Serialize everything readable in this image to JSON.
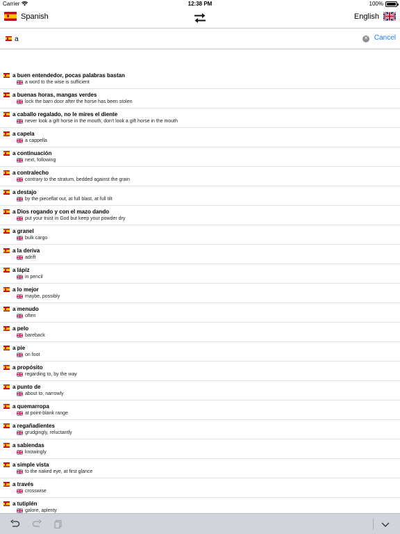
{
  "status": {
    "carrier": "Carrier",
    "time": "12:38 PM",
    "battery": "100%"
  },
  "nav": {
    "source_language": "Spanish",
    "target_language": "English"
  },
  "search": {
    "query": "a",
    "placeholder": "",
    "cancel_label": "Cancel"
  },
  "results": [
    {
      "term": "a buen entendedor, pocas palabras bastan",
      "translation": "a word to the wise is sufficient"
    },
    {
      "term": "a buenas horas, mangas verdes",
      "translation": "lock the barn door after the horse has been stolen"
    },
    {
      "term": "a caballo regalado, no le mires el diente",
      "translation": "never look a gift horse in the mouth, don't look a gift horse in the mouth"
    },
    {
      "term": "a capela",
      "translation": "a cappella"
    },
    {
      "term": "a continuación",
      "translation": "next, following"
    },
    {
      "term": "a contralecho",
      "translation": "contrary to the stratum, bedded against the grain"
    },
    {
      "term": "a destajo",
      "translation": "by the pieceflat out, at full blast, at full tilt"
    },
    {
      "term": "a Dios rogando y con el mazo dando",
      "translation": "put your trust in God but keep your powder dry"
    },
    {
      "term": "a granel",
      "translation": "bulk cargo"
    },
    {
      "term": "a la deriva",
      "translation": "adrift"
    },
    {
      "term": "a lápiz",
      "translation": "in pencil"
    },
    {
      "term": "a lo mejor",
      "translation": "maybe, possibly"
    },
    {
      "term": "a menudo",
      "translation": "often"
    },
    {
      "term": "a pelo",
      "translation": "bareback"
    },
    {
      "term": "a pie",
      "translation": "on foot"
    },
    {
      "term": "a propósito",
      "translation": "regarding to, by the way"
    },
    {
      "term": "a punto de",
      "translation": "about to, narrowly"
    },
    {
      "term": "a quemarropa",
      "translation": "at point-blank range"
    },
    {
      "term": "a regañadientes",
      "translation": "grudgingly, reluctantly"
    },
    {
      "term": "a sabiendas",
      "translation": "knowingly"
    },
    {
      "term": "a simple vista",
      "translation": "to the naked eye, at first glance"
    },
    {
      "term": "a través",
      "translation": "crosswise"
    },
    {
      "term": "a tutiplén",
      "translation": "galore, aplenty"
    }
  ],
  "icons": {
    "wifi": "wifi-icon",
    "swap": "swap-arrows-icon",
    "clear": "clear-circle-icon",
    "undo": "undo-icon",
    "redo": "redo-icon",
    "copy": "copy-icon",
    "hide_keyboard": "chevron-down-icon"
  },
  "colors": {
    "accent": "#1a7cf5",
    "toolbar": "#d1d5db",
    "separator": "#c8c7cc"
  }
}
